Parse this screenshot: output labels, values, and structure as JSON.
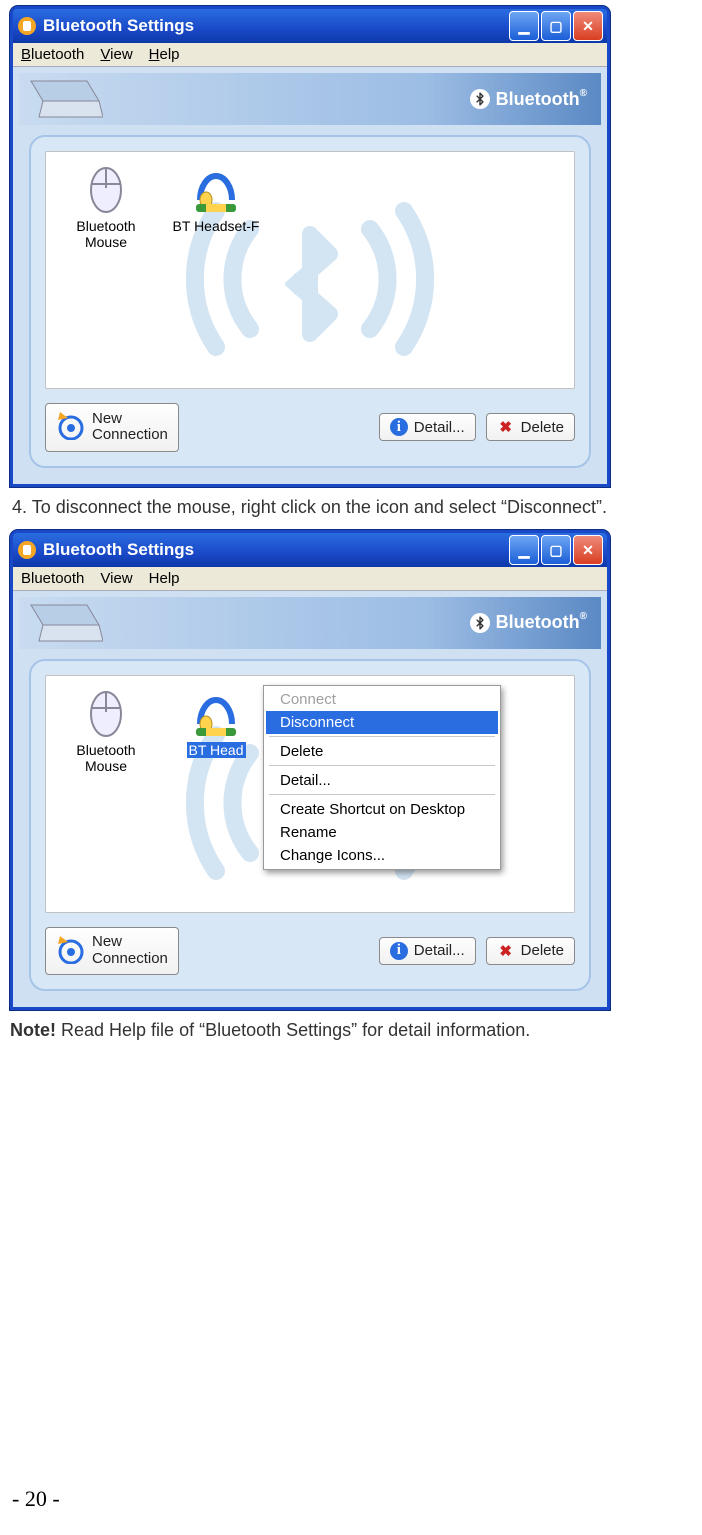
{
  "page_number": "- 20 -",
  "step4": "4.   To disconnect the mouse, right click on the icon and select “Disconnect”.",
  "note_bold": "Note!",
  "note_rest": " Read Help file of “Bluetooth Settings” for detail information.",
  "window": {
    "title": "Bluetooth Settings",
    "menu": {
      "bluetooth": "Bluetooth",
      "view": "View",
      "help": "Help"
    },
    "logo_text": "Bluetooth",
    "devices": {
      "mouse": "Bluetooth\nMouse",
      "headset": "BT Headset-F",
      "headset_truncated": "BT Head"
    },
    "buttons": {
      "new_connection": "New\nConnection",
      "detail": "Detail...",
      "delete": "Delete"
    }
  },
  "context_menu": {
    "connect": "Connect",
    "disconnect": "Disconnect",
    "delete": "Delete",
    "detail": "Detail...",
    "create_shortcut": "Create Shortcut on Desktop",
    "rename": "Rename",
    "change_icons": "Change Icons..."
  }
}
